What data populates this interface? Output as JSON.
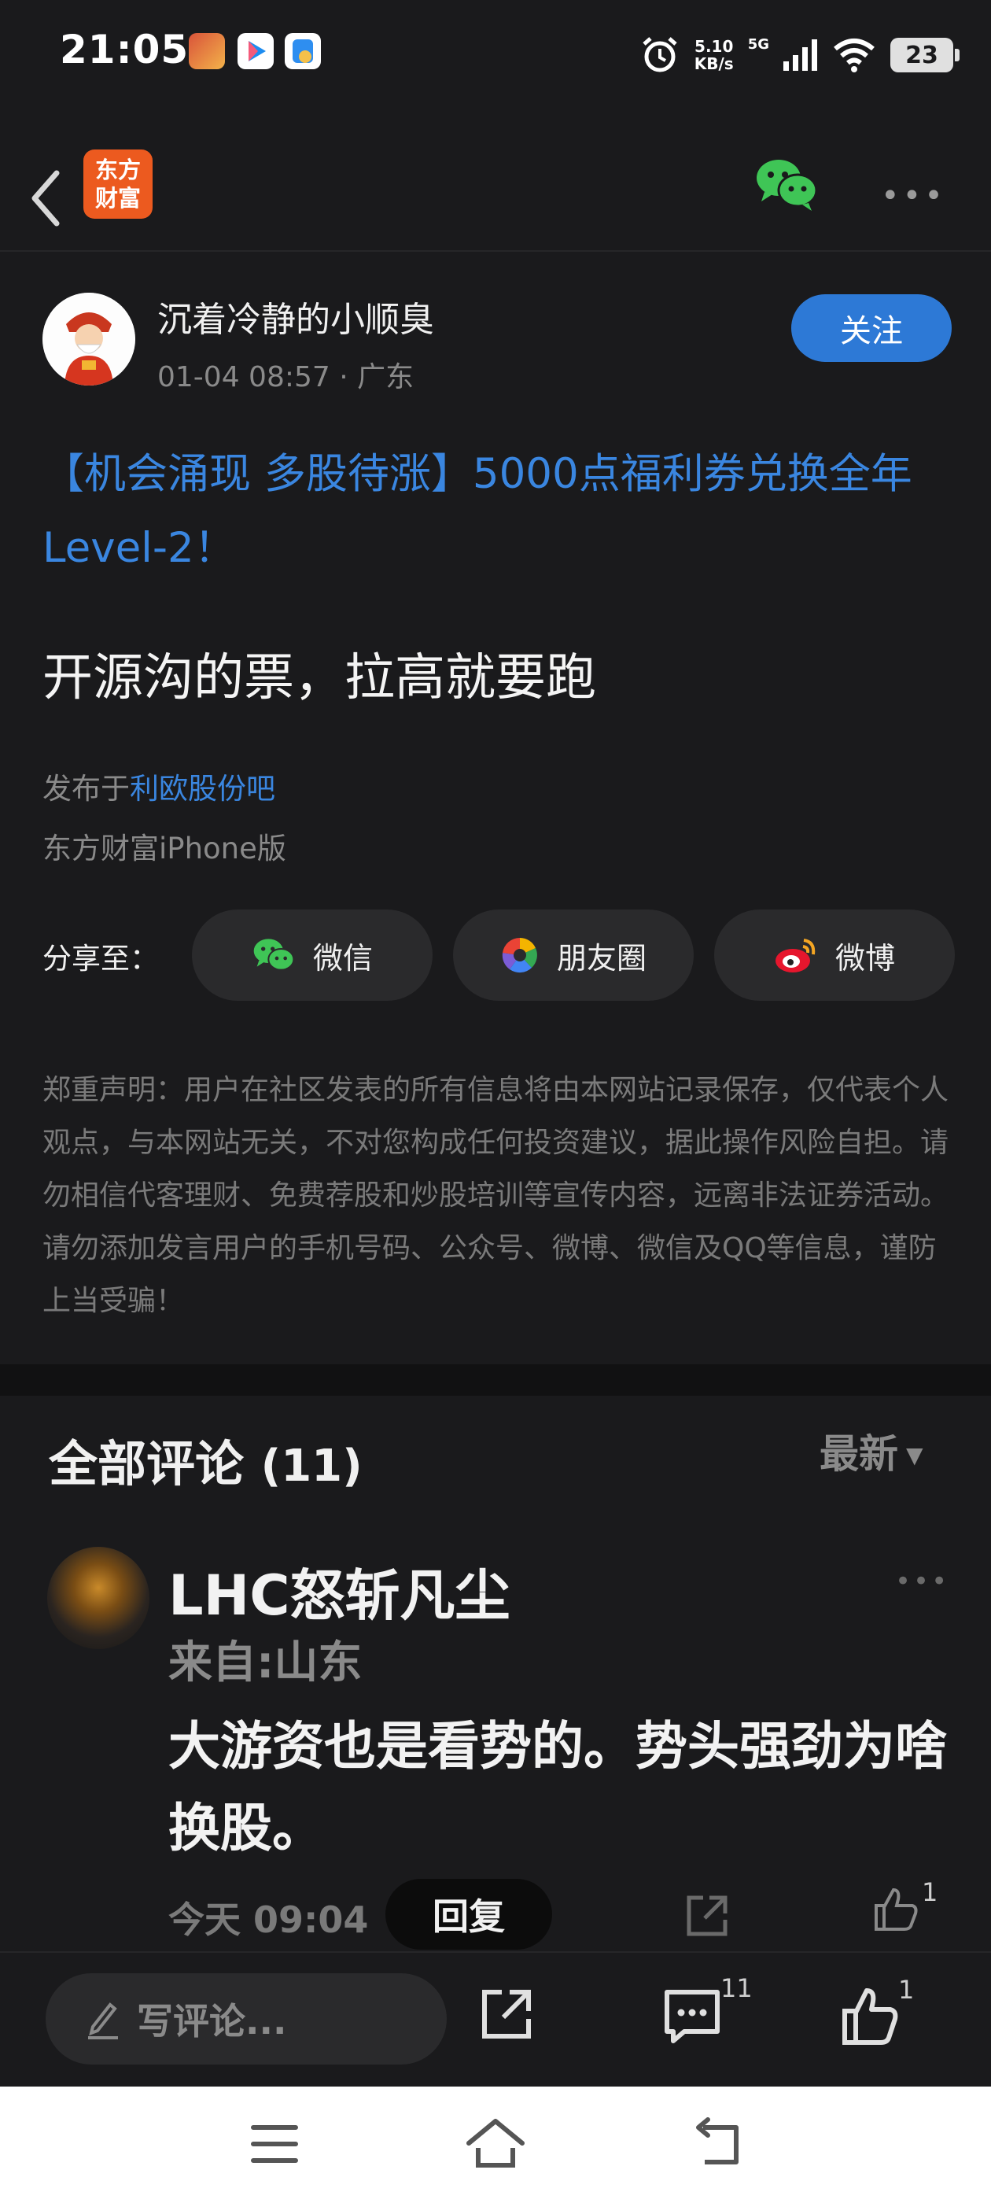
{
  "status_bar": {
    "time": "21:05",
    "net_speed_value": "5.10",
    "net_speed_unit": "KB/s",
    "network": "5G",
    "battery": "23"
  },
  "header": {
    "logo_line1": "东方",
    "logo_line2": "财富",
    "back_icon": "chevron-left-icon",
    "share_icon": "wechat-icon",
    "more_icon": "more-dots-icon"
  },
  "post": {
    "author": "沉着冷静的小顺臭",
    "meta": "01-04 08:57 · 广东",
    "follow_label": "关注",
    "promo": "【机会涌现 多股待涨】5000点福利券兑换全年Level-2！",
    "text": "开源沟的票，拉高就要跑",
    "published_prefix": "发布于",
    "published_forum": "利欧股份吧",
    "device": "东方财富iPhone版"
  },
  "share": {
    "label": "分享至：",
    "items": [
      {
        "label": "微信",
        "icon": "wechat-icon"
      },
      {
        "label": "朋友圈",
        "icon": "moments-icon"
      },
      {
        "label": "微博",
        "icon": "weibo-icon"
      }
    ]
  },
  "disclaimer": "郑重声明：用户在社区发表的所有信息将由本网站记录保存，仅代表个人观点，与本网站无关，不对您构成任何投资建议，据此操作风险自担。请勿相信代客理财、免费荐股和炒股培训等宣传内容，远离非法证券活动。请勿添加发言用户的手机号码、公众号、微博、微信及QQ等信息，谨防上当受骗！",
  "comments": {
    "title": "全部评论",
    "count": "(11)",
    "sort": "最新",
    "items": [
      {
        "user": "LHC怒斩凡尘",
        "from": "来自:山东",
        "body": "大游资也是看势的。势头强劲为啥换股。",
        "time": "今天 09:04",
        "reply_label": "回复",
        "likes": "1"
      }
    ]
  },
  "bottom_bar": {
    "placeholder": "写评论...",
    "comment_count": "11",
    "like_count": "1"
  },
  "colors": {
    "background": "#1a1a1c",
    "accent_blue": "#2d79d6",
    "link_blue": "#3a86e0",
    "brand_orange": "#ec5a1f",
    "wechat_green": "#3fc556"
  }
}
